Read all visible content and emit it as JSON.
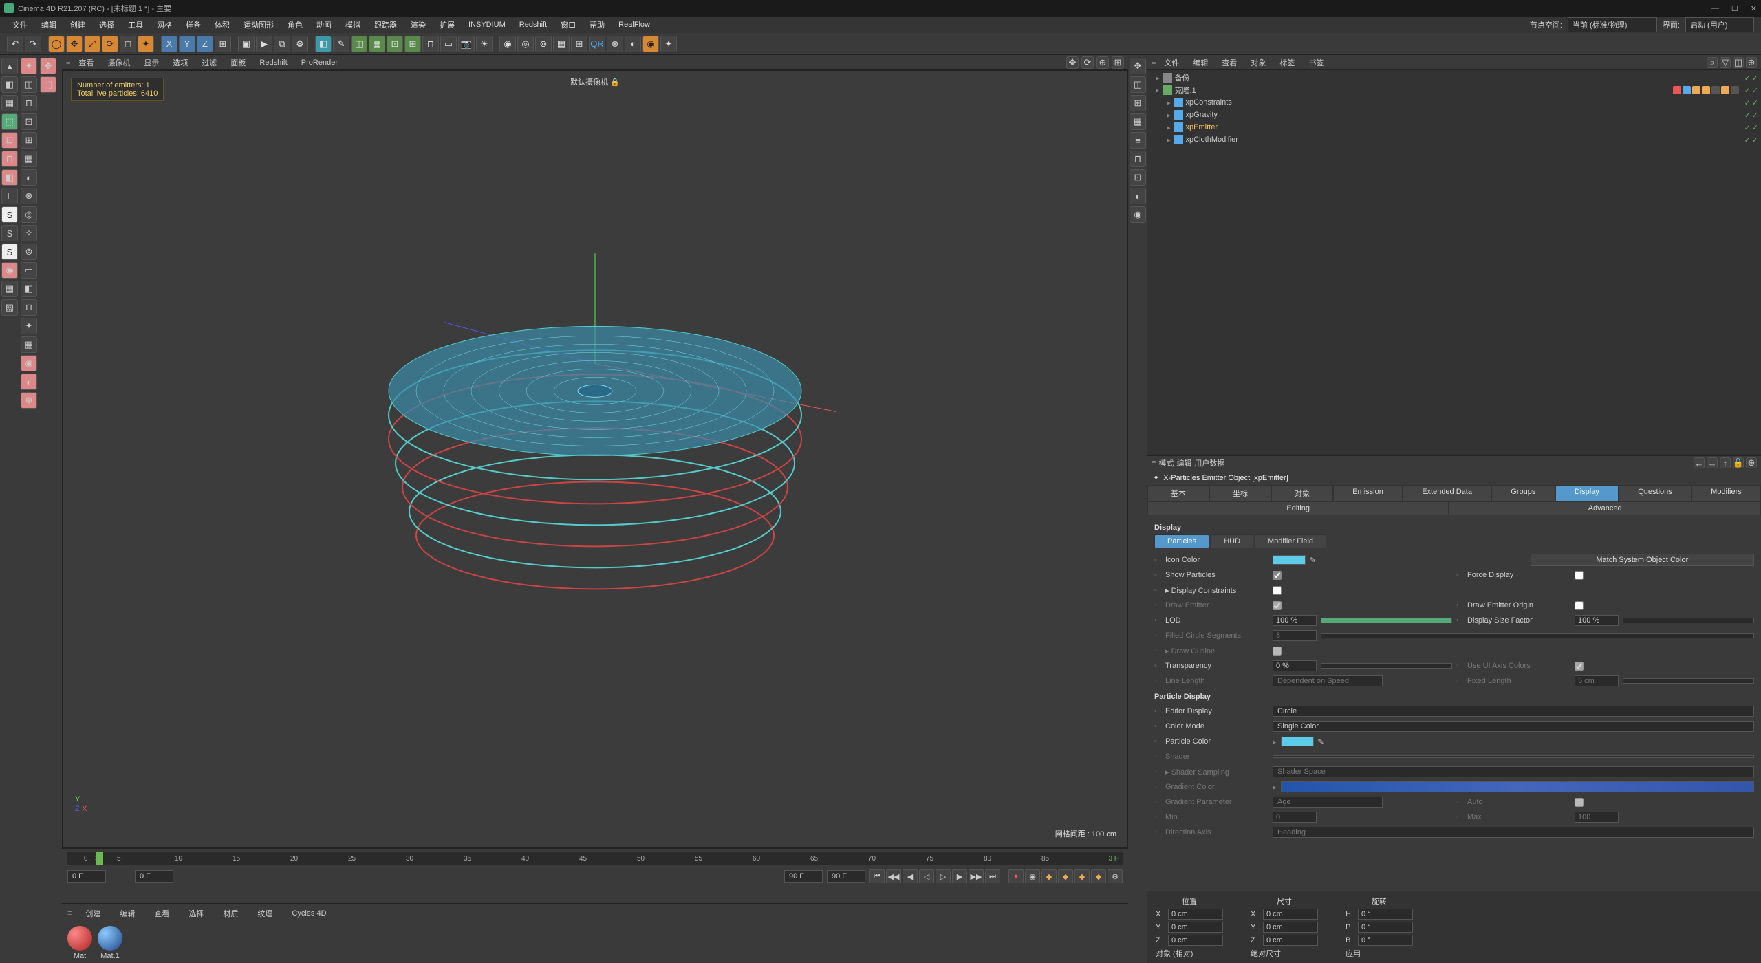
{
  "titlebar": {
    "title": "Cinema 4D R21.207 (RC) - [未标题 1 *] - 主要"
  },
  "menubar": {
    "items": [
      "文件",
      "编辑",
      "创建",
      "选择",
      "工具",
      "网格",
      "样条",
      "体积",
      "运动图形",
      "角色",
      "动画",
      "模拟",
      "跟踪器",
      "渲染",
      "扩展",
      "INSYDIUM",
      "Redshift",
      "窗口",
      "帮助",
      "RealFlow"
    ],
    "right_label1": "节点空间:",
    "right_val1": "当前 (标准/物理)",
    "right_label2": "界面:",
    "right_val2": "启动 (用户)"
  },
  "viewheader": {
    "items": [
      "查看",
      "摄像机",
      "显示",
      "选项",
      "过滤",
      "面板",
      "Redshift",
      "ProRender"
    ]
  },
  "viewport": {
    "emitters_label": "Number of emitters: 1",
    "particles_label": "Total live particles: 6410",
    "camera": "默认摄像机",
    "grid": "网格间距 : 100 cm"
  },
  "timeline": {
    "start": "0 F",
    "current": "0 F",
    "setend": "90 F",
    "end": "90 F",
    "ticks": [
      0,
      5,
      10,
      15,
      20,
      25,
      30,
      35,
      40,
      45,
      50,
      55,
      60,
      65,
      70,
      75,
      80,
      85
    ],
    "cursor": "3",
    "cursor_r": "3 F"
  },
  "materials": {
    "tabs": [
      "创建",
      "编辑",
      "查看",
      "选择",
      "材质",
      "纹理",
      "Cycles 4D"
    ],
    "items": [
      {
        "name": "Mat"
      },
      {
        "name": "Mat.1"
      }
    ]
  },
  "om": {
    "menus": [
      "文件",
      "编辑",
      "查看",
      "对象",
      "标签",
      "书签"
    ],
    "rows": [
      {
        "icon": "#888",
        "name": "备份",
        "indent": 0,
        "sel": false
      },
      {
        "icon": "#6a6",
        "name": "克隆.1",
        "indent": 0,
        "sel": false,
        "tags": [
          "#e55",
          "#5ae",
          "#ea5",
          "#ea5",
          "#555",
          "#ea5",
          "#555"
        ]
      },
      {
        "icon": "#5ae",
        "name": "xpConstraints",
        "indent": 1,
        "sel": false
      },
      {
        "icon": "#5ae",
        "name": "xpGravity",
        "indent": 1,
        "sel": false
      },
      {
        "icon": "#5ae",
        "name": "xpEmitter",
        "indent": 1,
        "sel": true
      },
      {
        "icon": "#5ae",
        "name": "xpClothModifier",
        "indent": 1,
        "sel": false
      }
    ]
  },
  "attr": {
    "menus": [
      "模式",
      "编辑",
      "用户数据"
    ],
    "title": "X-Particles Emitter Object [xpEmitter]",
    "tabs1": [
      "基本",
      "坐标",
      "对象",
      "Emission",
      "Extended Data",
      "Groups",
      "Display"
    ],
    "tabs2": [
      "Questions",
      "Modifiers",
      "Editing",
      "Advanced"
    ],
    "active_tab": "Display",
    "section_display": "Display",
    "subtabs": [
      "Particles",
      "HUD",
      "Modifier Field"
    ],
    "active_subtab": "Particles",
    "icon_color": "Icon Color",
    "icon_color_val": "#5ccce8",
    "match_btn": "Match System Object Color",
    "show_particles": "Show Particles",
    "force_display": "Force Display",
    "display_constraints": "Display Constraints",
    "draw_emitter": "Draw Emitter",
    "draw_emitter_origin": "Draw Emitter Origin",
    "lod": "LOD",
    "lod_val": "100 %",
    "display_size_factor": "Display Size Factor",
    "display_size_val": "100 %",
    "filled_circle": "Filled Circle Segments",
    "filled_circle_val": "8",
    "draw_outline": "Draw Outline",
    "transparency": "Transparency",
    "transparency_val": "0 %",
    "use_ui_axis": "Use UI Axis Colors",
    "line_length": "Line Length",
    "line_length_val": "Dependent on Speed",
    "fixed_length": "Fixed Length",
    "fixed_length_val": "5 cm",
    "section_particle": "Particle Display",
    "editor_display": "Editor Display",
    "editor_display_val": "Circle",
    "color_mode": "Color Mode",
    "color_mode_val": "Single Color",
    "particle_color": "Particle Color",
    "particle_color_val": "#5ccce8",
    "shader": "Shader",
    "shader_sampling": "Shader Sampling",
    "shader_sampling_val": "Shader Space",
    "gradient_color": "Gradient Color",
    "gradient_param": "Gradient Parameter",
    "gradient_param_val": "Age",
    "auto": "Auto",
    "min": "Min",
    "min_val": "0",
    "max": "Max",
    "max_val": "100",
    "direction_axis": "Direction Axis",
    "direction_axis_val": "Heading"
  },
  "coords": {
    "headers": [
      "位置",
      "尺寸",
      "旋转"
    ],
    "rows": [
      {
        "p": "X",
        "pv": "0 cm",
        "s": "X",
        "sv": "0 cm",
        "r": "H",
        "rv": "0 °"
      },
      {
        "p": "Y",
        "pv": "0 cm",
        "s": "Y",
        "sv": "0 cm",
        "r": "P",
        "rv": "0 °"
      },
      {
        "p": "Z",
        "pv": "0 cm",
        "s": "Z",
        "sv": "0 cm",
        "r": "B",
        "rv": "0 °"
      }
    ],
    "mode1": "对象 (相对)",
    "mode2": "绝对尺寸",
    "apply": "应用"
  }
}
